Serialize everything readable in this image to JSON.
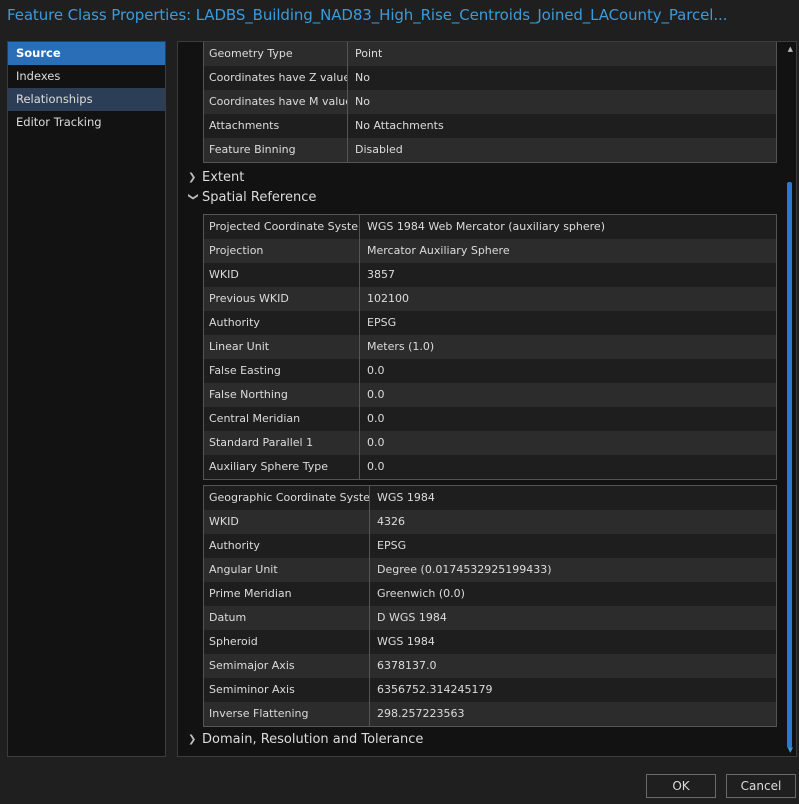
{
  "window": {
    "title": "Feature Class Properties: LADBS_Building_NAD83_High_Rise_Centroids_Joined_LACounty_Parcel..."
  },
  "nav": {
    "items": [
      {
        "label": "Source",
        "state": "active"
      },
      {
        "label": "Indexes",
        "state": ""
      },
      {
        "label": "Relationships",
        "state": "hover"
      },
      {
        "label": "Editor Tracking",
        "state": ""
      }
    ]
  },
  "general_table": [
    [
      "Geometry Type",
      "Point"
    ],
    [
      "Coordinates have Z value",
      "No"
    ],
    [
      "Coordinates have M value",
      "No"
    ],
    [
      "Attachments",
      "No Attachments"
    ],
    [
      "Feature Binning",
      "Disabled"
    ]
  ],
  "sections": {
    "extent": "Extent",
    "spatial_reference": "Spatial Reference",
    "domain": "Domain, Resolution and Tolerance"
  },
  "projected_table": [
    [
      "Projected Coordinate System",
      "WGS 1984 Web Mercator (auxiliary sphere)"
    ],
    [
      "Projection",
      "Mercator Auxiliary Sphere"
    ],
    [
      "WKID",
      "3857"
    ],
    [
      "Previous WKID",
      "102100"
    ],
    [
      "Authority",
      "EPSG"
    ],
    [
      "Linear Unit",
      "Meters (1.0)"
    ],
    [
      "False Easting",
      "0.0"
    ],
    [
      "False Northing",
      "0.0"
    ],
    [
      "Central Meridian",
      "0.0"
    ],
    [
      "Standard Parallel 1",
      "0.0"
    ],
    [
      "Auxiliary Sphere Type",
      "0.0"
    ]
  ],
  "geographic_table": [
    [
      "Geographic Coordinate System",
      "WGS 1984"
    ],
    [
      "WKID",
      "4326"
    ],
    [
      "Authority",
      "EPSG"
    ],
    [
      "Angular Unit",
      "Degree (0.0174532925199433)"
    ],
    [
      "Prime Meridian",
      "Greenwich (0.0)"
    ],
    [
      "Datum",
      "D WGS 1984"
    ],
    [
      "Spheroid",
      "WGS 1984"
    ],
    [
      "Semimajor Axis",
      "6378137.0"
    ],
    [
      "Semiminor Axis",
      "6356752.314245179"
    ],
    [
      "Inverse Flattening",
      "298.257223563"
    ]
  ],
  "buttons": {
    "ok": "OK",
    "cancel": "Cancel"
  },
  "colors": {
    "accent": "#2a6eb8",
    "title": "#3a9bdc",
    "scrollbar": "#2a79d0"
  }
}
